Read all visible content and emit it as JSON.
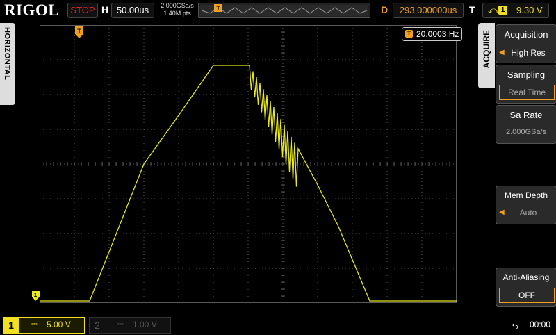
{
  "top_bar": {
    "brand": "RIGOL",
    "run_state": "STOP",
    "horizontal_label": "H",
    "timebase": "50.00us",
    "sample_rate": "2.000GSa/s",
    "memory_points": "1.40M pts",
    "delay_label": "D",
    "delay": "293.000000us",
    "trigger_label": "T",
    "trigger_source": "1",
    "trigger_level": "9.30 V"
  },
  "left_tab": {
    "label": "HORIZONTAL"
  },
  "measurement": {
    "icon": "T",
    "frequency": "20.0003 Hz"
  },
  "right_menu": {
    "tab_label": "ACQUIRE",
    "items": [
      {
        "title": "Acquisition",
        "value": "High Res"
      },
      {
        "title": "Sampling",
        "value": "Real Time"
      },
      {
        "title": "Sa Rate",
        "value": "2.000GSa/s"
      },
      {
        "title": "Mem Depth",
        "value": "Auto"
      },
      {
        "title": "Anti-Aliasing",
        "value": "OFF"
      }
    ]
  },
  "bottom_bar": {
    "ch1": {
      "number": "1",
      "coupling": "⎓",
      "scale": "5.00 V"
    },
    "ch2": {
      "number": "2",
      "coupling": "⎓",
      "scale": "1.00 V"
    },
    "usb_icon": "usb-icon",
    "time": "00:00"
  },
  "colors": {
    "ch1_trace": "#e8e820",
    "grid": "#5a5a5a",
    "accent_orange": "#f0a020",
    "stop_red": "#dd2222"
  }
}
